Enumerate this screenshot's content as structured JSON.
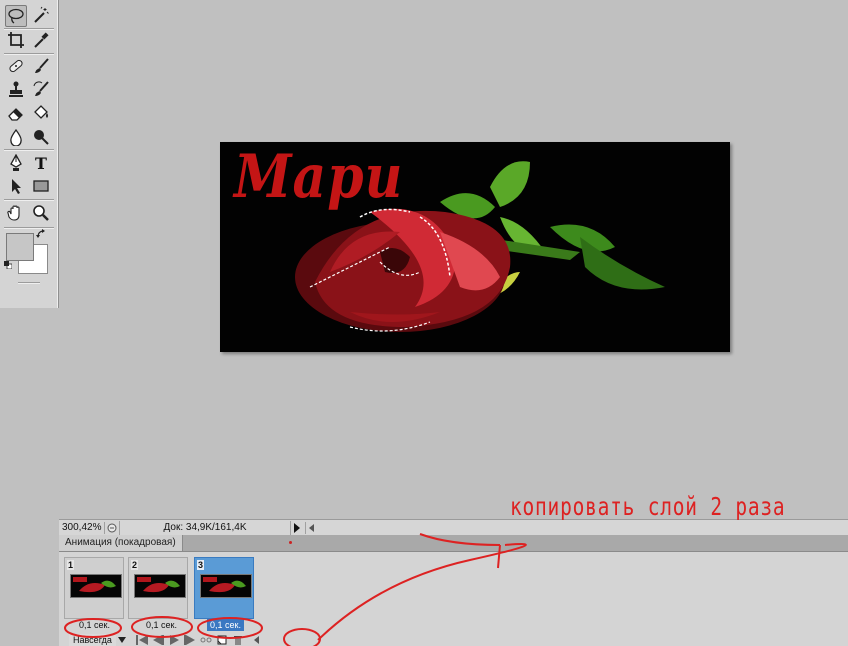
{
  "toolbox": {
    "tools": [
      {
        "name": "lasso-tool",
        "icon": "lasso-icon"
      },
      {
        "name": "magic-wand-tool",
        "icon": "magic-wand-icon"
      },
      {
        "name": "crop-tool",
        "icon": "crop-icon"
      },
      {
        "name": "eyedropper-tool",
        "icon": "eyedropper-icon"
      },
      {
        "name": "healing-brush-tool",
        "icon": "bandage-icon"
      },
      {
        "name": "brush-tool",
        "icon": "brush-icon"
      },
      {
        "name": "clone-stamp-tool",
        "icon": "stamp-icon"
      },
      {
        "name": "history-brush-tool",
        "icon": "history-brush-icon"
      },
      {
        "name": "eraser-tool",
        "icon": "eraser-icon"
      },
      {
        "name": "paint-bucket-tool",
        "icon": "bucket-icon"
      },
      {
        "name": "blur-tool",
        "icon": "drop-icon"
      },
      {
        "name": "dodge-tool",
        "icon": "dodge-icon"
      },
      {
        "name": "pen-tool",
        "icon": "pen-icon"
      },
      {
        "name": "type-tool",
        "icon": "type-icon",
        "glyph": "T"
      },
      {
        "name": "path-selection-tool",
        "icon": "arrow-icon"
      },
      {
        "name": "rectangle-tool",
        "icon": "rectangle-icon"
      },
      {
        "name": "hand-tool",
        "icon": "hand-icon"
      },
      {
        "name": "zoom-tool",
        "icon": "magnifier-icon"
      }
    ],
    "foreground_color": "#c6c6c6",
    "background_color": "#ffffff"
  },
  "document": {
    "title_text": "Мари",
    "title_color": "#c41515",
    "background_color": "#020202"
  },
  "status": {
    "zoom": "300,42%",
    "doc_info": "Док: 34,9K/161,4K"
  },
  "animation": {
    "panel_title": "Анимация (покадровая)",
    "frames": [
      {
        "number": "1",
        "delay": "0,1 сек."
      },
      {
        "number": "2",
        "delay": "0,1 сек."
      },
      {
        "number": "3",
        "delay": "0,1 сек."
      }
    ],
    "selected_frame": 3,
    "loop": "Навсегда"
  },
  "annotation": {
    "text": "копировать слой 2 раза",
    "color": "#dd2222"
  }
}
